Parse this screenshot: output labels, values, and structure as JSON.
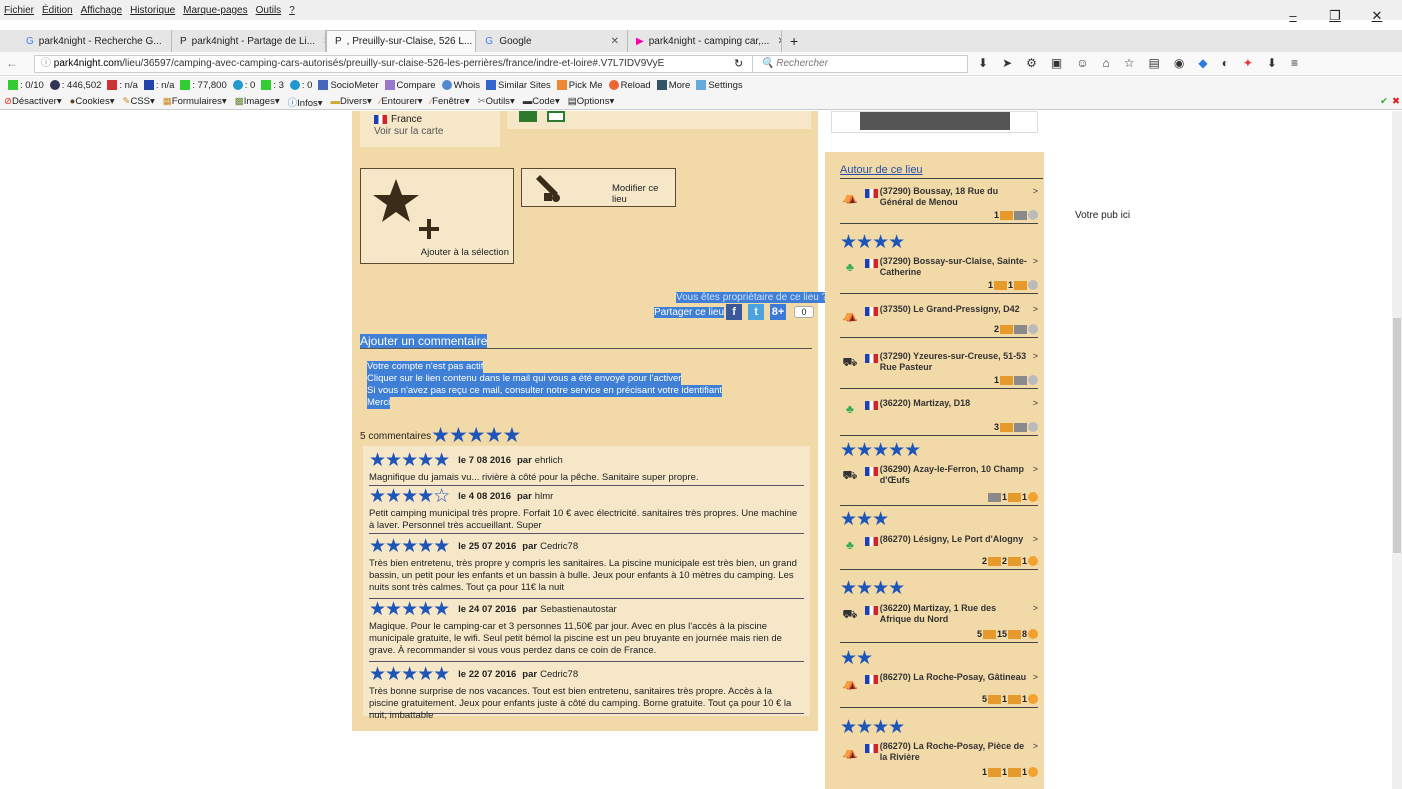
{
  "menu": [
    "Fichier",
    "Édition",
    "Affichage",
    "Historique",
    "Marque-pages",
    "Outils",
    "?"
  ],
  "window_controls": [
    "–",
    "❐",
    "✕"
  ],
  "tabs": [
    {
      "label": "park4night - Recherche G...",
      "icon": "G"
    },
    {
      "label": "park4night - Partage de Li...",
      "icon": "P"
    },
    {
      "label": ", Preuilly-sur-Claise, 526 L...",
      "icon": "P"
    },
    {
      "label": "Google",
      "icon": "G"
    },
    {
      "label": "park4night - camping car,...",
      "icon": "▶"
    }
  ],
  "url": {
    "host": "park4night.com",
    "path": "/lieu/36597/camping-avec-camping-cars-autorisés/preuilly-sur-claise-526-les-perrières/france/indre-et-loire#.V7L7IDV9VyE"
  },
  "search_placeholder": "Rechercher",
  "bookmarks1": [
    ": 0/10",
    ": 446,502",
    ": n/a",
    ": n/a",
    ": 77,800",
    ": 0",
    ": 3",
    ": 0",
    "SocioMeter",
    "Compare",
    "Whois",
    "Similar Sites",
    "Pick Me",
    "Reload",
    "More",
    "Settings"
  ],
  "bookmarks2": [
    "Désactiver",
    "Cookies",
    "CSS",
    "Formulaires",
    "Images",
    "Infos",
    "Divers",
    "Entourer",
    "Fenêtre",
    "Outils",
    "Code",
    "Options"
  ],
  "address": {
    "country": "France",
    "map_link": "Voir sur la carte"
  },
  "add_selection": "Ajouter à la sélection",
  "edit_place": "Modifier ce lieu",
  "owner_link": "Vous êtes propriétaire de ce lieu ?",
  "share_label": "Partager ce lieu",
  "share_count": "0",
  "add_comment": "Ajouter un commentaire",
  "message": [
    "Votre compte n'est pas actif",
    "Cliquer sur le lien contenu dans le mail qui vous a été envoyé pour l'activer",
    "Si vous n'avez pas reçu ce mail, consulter notre service en précisant votre identifiant",
    "Merci"
  ],
  "comments_count": "5 commentaires",
  "reviews": [
    {
      "stars": "★★★★★",
      "date": "le 7 08 2016",
      "par": "par",
      "author": "ehrlich",
      "text": "Magnifique du jamais vu... rivière à côté pour la pêche. Sanitaire super propre."
    },
    {
      "stars": "★★★★☆",
      "date": "le 4 08 2016",
      "par": "par",
      "author": "hlmr",
      "text": "Petit camping municipal très propre. Forfait 10 € avec électricité. sanitaires très propres. Une machine à laver. Personnel très accueillant. Super"
    },
    {
      "stars": "★★★★★",
      "date": "le 25 07 2016",
      "par": "par",
      "author": "Cedric78",
      "text": "Très bien entretenu, très propre y compris les sanitaires. La piscine municipale est très bien, un grand bassin, un petit pour les enfants et un bassin à bulle. Jeux pour enfants à 10 mètres du camping. Les nuits sont très calmes. Tout ça pour 11€ la nuit"
    },
    {
      "stars": "★★★★★",
      "date": "le 24 07 2016",
      "par": "par",
      "author": "Sebastienautostar",
      "text": "Magique. Pour le camping-car et 3 personnes 11,50€ par jour. Avec en plus l'accès à la piscine municipale gratuite, le wifi. Seul petit bémol la piscine est un peu bruyante en journée mais rien de grave. À recommander si vous vous perdez dans ce coin de France."
    },
    {
      "stars": "★★★★★",
      "date": "le 22 07 2016",
      "par": "par",
      "author": "Cedric78",
      "text": "Très bonne surprise de nos vacances. Tout est bien entretenu, sanitaires très propre. Accès à la piscine gratuitement. Jeux pour enfants juste à côté du camping. Borne gratuite. Tout ça pour 10 € la nuit, imbattable"
    }
  ],
  "around_title": "Autour de ce lieu",
  "places": [
    {
      "name": "(37290) Boussay, 18 Rue du Général de Menou",
      "counts": [
        "1"
      ],
      "stars": "★★★★"
    },
    {
      "name": "(37290) Bossay-sur-Claise, Sainte-Catherine",
      "counts": [
        "1",
        "1"
      ],
      "stars": ""
    },
    {
      "name": "(37350) Le Grand-Pressigny, D42",
      "counts": [
        "2"
      ],
      "stars": ""
    },
    {
      "name": "(37290) Yzeures-sur-Creuse, 51-53 Rue Pasteur",
      "counts": [
        "1"
      ],
      "stars": ""
    },
    {
      "name": "(36220) Martizay, D18",
      "counts": [
        "3"
      ],
      "stars": "★★★★★"
    },
    {
      "name": "(36290) Azay-le-Ferron, 10 Champ d'Œufs",
      "counts": [
        "1",
        "1"
      ],
      "stars": "★★★"
    },
    {
      "name": "(86270) Lésigny, Le Port d'Alogny",
      "counts": [
        "2",
        "2",
        "1"
      ],
      "stars": "★★★★"
    },
    {
      "name": "(36220) Martizay, 1 Rue des Afrique du Nord",
      "counts": [
        "5",
        "15",
        "8"
      ],
      "stars": "★★"
    },
    {
      "name": "(86270) La Roche-Posay, Gâtineau",
      "counts": [
        "5",
        "1",
        "1"
      ],
      "stars": "★★★★"
    },
    {
      "name": "(86270) La Roche-Posay, Pièce de la Rivière",
      "counts": [
        "1",
        "1",
        "1"
      ],
      "stars": ""
    }
  ],
  "pub": "Votre pub ici"
}
